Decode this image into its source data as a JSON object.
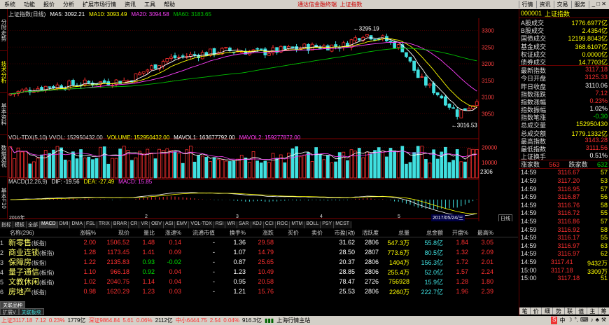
{
  "menu": {
    "items": [
      "系统",
      "功能",
      "报价",
      "分析",
      "扩展市场行情",
      "资讯",
      "工具",
      "帮助"
    ],
    "center": "通达信金融终端",
    "center2": "上证指数",
    "right": [
      "行情",
      "资讯",
      "交易",
      "服务"
    ]
  },
  "leftstrip": [
    "分时走势",
    "技术分析",
    "基本资料",
    "数据透视",
    "基本F10"
  ],
  "chart": {
    "title": "上证指数(日线)",
    "ma5": "MA5: 3092.21",
    "ma10": "MA10: 3093.49",
    "ma20": "MA20: 3094.58",
    "ma60": "MA60: 3183.65",
    "ylabels": [
      "3300",
      "3250",
      "3200",
      "3150",
      "3100",
      "3050"
    ],
    "high_label": "3295.19",
    "low_label": "3016.53",
    "vol_title": "VOL-TDX(5,10)  VVOL: 152950432.00",
    "vol": "VOLUME: 152950432.00",
    "mavol1": "MAVOL1: 163677792.00",
    "mavol2": "MAVOL2: 159277872.00",
    "vol_ylabels": [
      "20000",
      "10000"
    ],
    "vol_tag": "2306",
    "macd_title": "MACD(12,26,9)",
    "dif": "DIF: -19.56",
    "dea": "DEA: -27.49",
    "macd": "MACD: 15.85",
    "dates": [
      "2016年",
      "2",
      "3",
      "4",
      "5"
    ],
    "date_tag": "2017/05/24/三",
    "period": "日线",
    "colors": {
      "up": "#ff3030",
      "down": "#40e0e0",
      "ma5": "#ffffff",
      "ma10": "#ffff00",
      "ma20": "#ff40ff",
      "ma60": "#00c000"
    }
  },
  "tabs": [
    "指标",
    "模板",
    "全部",
    "MACD",
    "DMI",
    "DMA",
    "FSL",
    "TRIX",
    "BRAR",
    "CR",
    "VR",
    "OBV",
    "ASI",
    "EMV",
    "VOL-TDX",
    "RSI",
    "WR",
    "SAR",
    "KDJ",
    "CCI",
    "ROC",
    "MTM",
    "BOLL",
    "PSY",
    "MCST"
  ],
  "table": {
    "headers": [
      "名称(296)",
      "涨幅%",
      "现价",
      "量比",
      "涨速%",
      "流通市值",
      "换手%",
      "涨跌",
      "买价",
      "卖价",
      "市盈(动)",
      "活跃度",
      "总量",
      "总金额",
      "开盘%",
      "最高%"
    ],
    "rows": [
      {
        "idx": "1",
        "name": "新零售",
        "tag": "(板指)",
        "chg": "2.00",
        "price": "1506.52",
        "vr": "1.48",
        "spd": "0.14",
        "mv": "-",
        "turn": "1.36",
        "diff": "29.58",
        "buy": "",
        "sell": "",
        "pe": "31.62",
        "act": "2806",
        "vol": "547.3万",
        "amt": "55.8亿",
        "open": "1.84",
        "high": "3.05"
      },
      {
        "idx": "2",
        "name": "商业连锁",
        "tag": "(板指)",
        "chg": "1.28",
        "price": "1173.45",
        "vr": "1.41",
        "spd": "0.09",
        "mv": "-",
        "turn": "1.07",
        "diff": "14.79",
        "buy": "",
        "sell": "",
        "pe": "28.50",
        "act": "2807",
        "vol": "773.6万",
        "amt": "80.5亿",
        "open": "1.32",
        "high": "2.09"
      },
      {
        "idx": "3",
        "name": "保障房",
        "tag": "(板指)",
        "chg": "1.22",
        "price": "2135.83",
        "vr": "0.93",
        "spd": "-0.02",
        "mv": "-",
        "turn": "0.87",
        "diff": "25.65",
        "buy": "",
        "sell": "",
        "pe": "20.37",
        "act": "2806",
        "vol": "1404万",
        "amt": "156.3亿",
        "open": "1.72",
        "high": "2.01"
      },
      {
        "idx": "4",
        "name": "量子通信",
        "tag": "(板指)",
        "chg": "1.10",
        "price": "966.18",
        "vr": "0.92",
        "spd": "0.04",
        "mv": "-",
        "turn": "1.23",
        "diff": "10.49",
        "buy": "",
        "sell": "",
        "pe": "28.85",
        "act": "2806",
        "vol": "255.4万",
        "amt": "52.0亿",
        "open": "1.57",
        "high": "2.24"
      },
      {
        "idx": "5",
        "name": "文教休闲",
        "tag": "(板指)",
        "chg": "1.02",
        "price": "2040.75",
        "vr": "1.14",
        "spd": "0.04",
        "mv": "-",
        "turn": "0.95",
        "diff": "20.58",
        "buy": "",
        "sell": "",
        "pe": "78.47",
        "act": "2726",
        "vol": "756928",
        "amt": "15.9亿",
        "open": "1.28",
        "high": "1.80"
      },
      {
        "idx": "6",
        "name": "房地产",
        "tag": "(板指)",
        "chg": "0.98",
        "price": "1620.29",
        "vr": "1.23",
        "spd": "0.03",
        "mv": "-",
        "turn": "1.21",
        "diff": "15.76",
        "buy": "",
        "sell": "",
        "pe": "25.53",
        "act": "2806",
        "vol": "2260万",
        "amt": "222.7亿",
        "open": "1.96",
        "high": "2.39"
      }
    ]
  },
  "bottomtabs": [
    "关联品种",
    "扩展V",
    "关联板块"
  ],
  "right": {
    "code": "000001",
    "name": "上证指数",
    "stats": [
      {
        "k": "A股成交",
        "v": "1776.6977亿"
      },
      {
        "k": "B股成交",
        "v": "2.4354亿"
      },
      {
        "k": "国债成交",
        "v": "12199.8043亿"
      },
      {
        "k": "基金成交",
        "v": "368.6107亿"
      },
      {
        "k": "权证成交",
        "v": "0.0000亿"
      },
      {
        "k": "债券成交",
        "v": "14.7703亿"
      }
    ],
    "quote": [
      {
        "k": "最新指数",
        "v": "3117.18",
        "c": "red"
      },
      {
        "k": "今日开盘",
        "v": "3125.33",
        "c": "red"
      },
      {
        "k": "昨日收盘",
        "v": "3110.06",
        "c": "wht"
      },
      {
        "k": "指数涨跌",
        "v": "7.12",
        "c": "red"
      },
      {
        "k": "指数涨幅",
        "v": "0.23%",
        "c": "red"
      },
      {
        "k": "指数振幅",
        "v": "1.02%",
        "c": "wht"
      },
      {
        "k": "指数笔涨",
        "v": "-0.30",
        "c": "grn"
      },
      {
        "k": "总成交量",
        "v": "152950430",
        "c": "yel"
      },
      {
        "k": "总成交额",
        "v": "1779.1332亿",
        "c": "yel"
      },
      {
        "k": "最高指数",
        "v": "3143.28",
        "c": "red"
      },
      {
        "k": "最低指数",
        "v": "3111.56",
        "c": "red"
      },
      {
        "k": "上证换手",
        "v": "0.51%",
        "c": "wht"
      }
    ],
    "updown": {
      "up_label": "涨家数",
      "up": "563",
      "down_label": "跌家数",
      "down": "632"
    },
    "ticks": [
      [
        "14:59",
        "3116.67",
        "57"
      ],
      [
        "14:59",
        "3117.20",
        "53"
      ],
      [
        "14:59",
        "3116.95",
        "57"
      ],
      [
        "14:59",
        "3116.87",
        "56"
      ],
      [
        "14:59",
        "3116.76",
        "58"
      ],
      [
        "14:59",
        "3116.72",
        "55"
      ],
      [
        "14:59",
        "3116.86",
        "57"
      ],
      [
        "14:59",
        "3116.92",
        "58"
      ],
      [
        "14:59",
        "3116.17",
        "55"
      ],
      [
        "14:59",
        "3116.97",
        "63"
      ],
      [
        "14:59",
        "3116.97",
        "62"
      ],
      [
        "14:59",
        "3117.41",
        "9432万"
      ],
      [
        "15:00",
        "3117.18",
        "3309万"
      ],
      [
        "15:00",
        "3117.18",
        "51"
      ]
    ],
    "bottom": [
      "笔",
      "价",
      "细",
      "势",
      "联",
      "值",
      "主",
      "筹"
    ]
  },
  "status": {
    "sh": "上证3117.18",
    "sh_chg": "7.12",
    "sh_pct": "0.23%",
    "sh_amt": "1779亿",
    "sz": "深证9864.84",
    "sz_chg": "5.61",
    "sz_pct": "0.06%",
    "sz_amt": "2112亿",
    "zx": "中小6444.75",
    "zx_chg": "2.54",
    "zx_pct": "0.04%",
    "zx_amt": "916.3亿",
    "site": "上海行情主站"
  }
}
